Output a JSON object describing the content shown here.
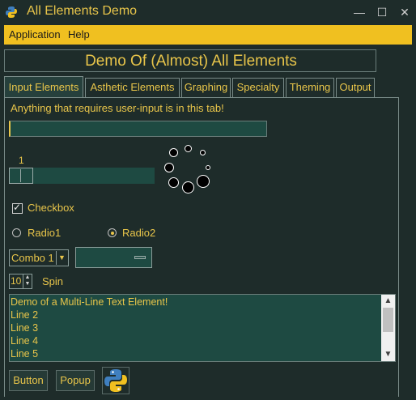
{
  "window": {
    "title": "All Elements Demo",
    "controls": {
      "minimize": "—",
      "maximize": "☐",
      "close": "✕"
    }
  },
  "menubar": {
    "items": [
      {
        "label": "Application"
      },
      {
        "label": "Help"
      }
    ]
  },
  "main_title": "Demo Of (Almost) All Elements",
  "tabs": [
    {
      "label": "Input Elements",
      "active": true
    },
    {
      "label": "Asthetic Elements",
      "active": false
    },
    {
      "label": "Graphing",
      "active": false
    },
    {
      "label": "Specialty",
      "active": false
    },
    {
      "label": "Theming",
      "active": false
    },
    {
      "label": "Output",
      "active": false
    }
  ],
  "input_tab": {
    "description": "Anything that requires user-input is in this tab!",
    "text_input": {
      "value": ""
    },
    "slider": {
      "value": "1",
      "level": 0.0
    },
    "checkbox": {
      "label": "Checkbox",
      "checked": true,
      "mark": "✓"
    },
    "radios": [
      {
        "label": "Radio1",
        "selected": false
      },
      {
        "label": "Radio2",
        "selected": true
      }
    ],
    "combo": {
      "value": "Combo 1",
      "arrow": "▼"
    },
    "option_menu": {
      "value": ""
    },
    "spin": {
      "value": "10",
      "label": "Spin",
      "up": "▲",
      "down": "▼"
    },
    "multiline": {
      "lines": [
        "Demo of a Multi-Line Text Element!",
        "Line 2",
        "Line 3",
        "Line 4",
        "Line 5"
      ],
      "scroll_up": "▲",
      "scroll_down": "▼"
    },
    "buttons": {
      "button_label": "Button",
      "popup_label": "Popup"
    }
  },
  "colors": {
    "background": "#1e2c2a",
    "accent": "#e8c54a",
    "menubar": "#f0c020",
    "input_bg": "#1e4a42"
  }
}
